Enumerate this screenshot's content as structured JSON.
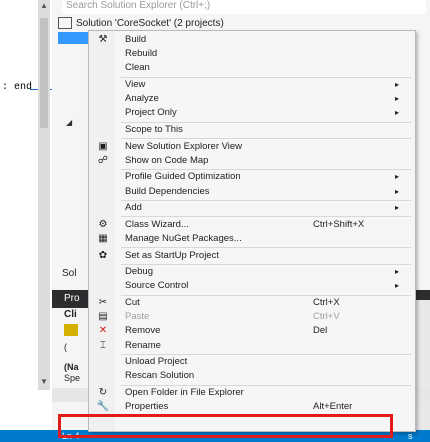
{
  "solution_explorer": {
    "search_placeholder": "Search Solution Explorer (Ctrl+;)",
    "root_label": "Solution 'CoreSocket' (2 projects)",
    "sol_label": "Sol",
    "bottom_tab": "Pro",
    "props_cli": "Cli",
    "props_paren": "(",
    "props_na": "(Na",
    "props_spe": "Spe"
  },
  "editor": {
    "text": ": end"
  },
  "status": {
    "line": "Ln 4",
    "right": "s"
  },
  "context_menu": {
    "items": [
      {
        "label": "Build",
        "icon": "build-icon",
        "glyph": "⚒"
      },
      {
        "label": "Rebuild"
      },
      {
        "label": "Clean"
      },
      {
        "label": "View",
        "submenu": true
      },
      {
        "label": "Analyze",
        "submenu": true
      },
      {
        "label": "Project Only",
        "submenu": true
      },
      {
        "label": "Scope to This"
      },
      {
        "label": "New Solution Explorer View",
        "icon": "new-view-icon",
        "glyph": "▣"
      },
      {
        "label": "Show on Code Map",
        "icon": "code-map-icon",
        "glyph": "☍"
      },
      {
        "label": "Profile Guided Optimization",
        "submenu": true
      },
      {
        "label": "Build Dependencies",
        "submenu": true
      },
      {
        "label": "Add",
        "submenu": true
      },
      {
        "label": "Class Wizard...",
        "shortcut": "Ctrl+Shift+X",
        "icon": "class-wizard-icon",
        "glyph": "⚙"
      },
      {
        "label": "Manage NuGet Packages...",
        "icon": "nuget-icon",
        "glyph": "▦"
      },
      {
        "label": "Set as StartUp Project",
        "icon": "startup-icon",
        "glyph": "✿"
      },
      {
        "label": "Debug",
        "submenu": true
      },
      {
        "label": "Source Control",
        "submenu": true
      },
      {
        "label": "Cut",
        "shortcut": "Ctrl+X",
        "icon": "cut-icon",
        "glyph": "✂"
      },
      {
        "label": "Paste",
        "shortcut": "Ctrl+V",
        "disabled": true,
        "icon": "paste-icon",
        "glyph": "▤"
      },
      {
        "label": "Remove",
        "shortcut": "Del",
        "icon": "remove-icon",
        "glyph": "✕"
      },
      {
        "label": "Rename",
        "icon": "rename-icon",
        "glyph": "⌶"
      },
      {
        "label": "Unload Project"
      },
      {
        "label": "Rescan Solution"
      },
      {
        "label": "Open Folder in File Explorer",
        "icon": "open-folder-icon",
        "glyph": "↻"
      },
      {
        "label": "Properties",
        "shortcut": "Alt+Enter",
        "icon": "wrench-icon",
        "glyph": "🔧"
      }
    ]
  },
  "colors": {
    "accent": "#007acc",
    "highlight_box": "#e01b1b",
    "remove_icon": "#d11a1a"
  }
}
